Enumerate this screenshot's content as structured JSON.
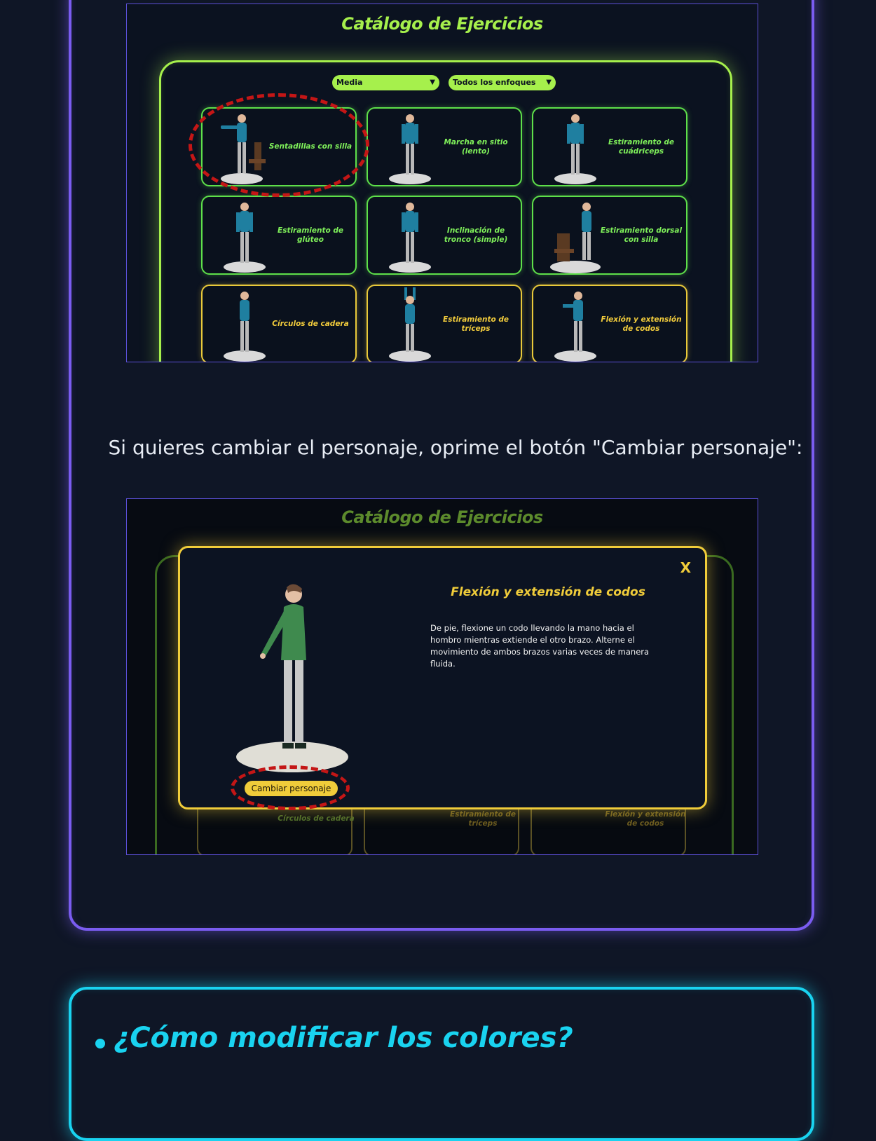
{
  "screenshot1": {
    "title": "Catálogo de Ejercicios",
    "filters": {
      "difficulty": "Media",
      "focus": "Todos los enfoques"
    },
    "exercises": [
      {
        "name": "Sentadillas con silla",
        "color": "green"
      },
      {
        "name": "Marcha en sitio (lento)",
        "color": "green"
      },
      {
        "name": "Estiramiento de cuádriceps",
        "color": "green"
      },
      {
        "name": "Estiramiento de glúteo",
        "color": "green"
      },
      {
        "name": "Inclinación de tronco (simple)",
        "color": "green"
      },
      {
        "name": "Estiramiento dorsal con silla",
        "color": "green"
      },
      {
        "name": "Círculos de cadera",
        "color": "yellow"
      },
      {
        "name": "Estiramiento de tríceps",
        "color": "yellow"
      },
      {
        "name": "Flexión y extensión de codos",
        "color": "yellow"
      }
    ]
  },
  "instruction_text": "Si quieres cambiar el personaje, oprime el botón \"Cambiar personaje\":",
  "screenshot2": {
    "title": "Catálogo de Ejercicios",
    "modal": {
      "close_label": "X",
      "title": "Flexión y extensión de codos",
      "description": "De pie, flexione un codo llevando la mano hacia el hombro mientras extiende el otro brazo. Alterne el movimiento de ambos brazos varias veces de manera fluida.",
      "change_character_label": "Cambiar personaje"
    },
    "background_cards": [
      "Círculos de cadera",
      "Estiramiento de tríceps",
      "Flexión y extensión de codos"
    ]
  },
  "next_section": {
    "title": "¿Cómo modificar los colores?"
  },
  "colors": {
    "purple_border": "#7a5cf0",
    "cyan_border": "#19d3f0",
    "green_accent": "#a6f04c",
    "yellow_accent": "#f0cc3a",
    "highlight_ring": "#c41616"
  }
}
